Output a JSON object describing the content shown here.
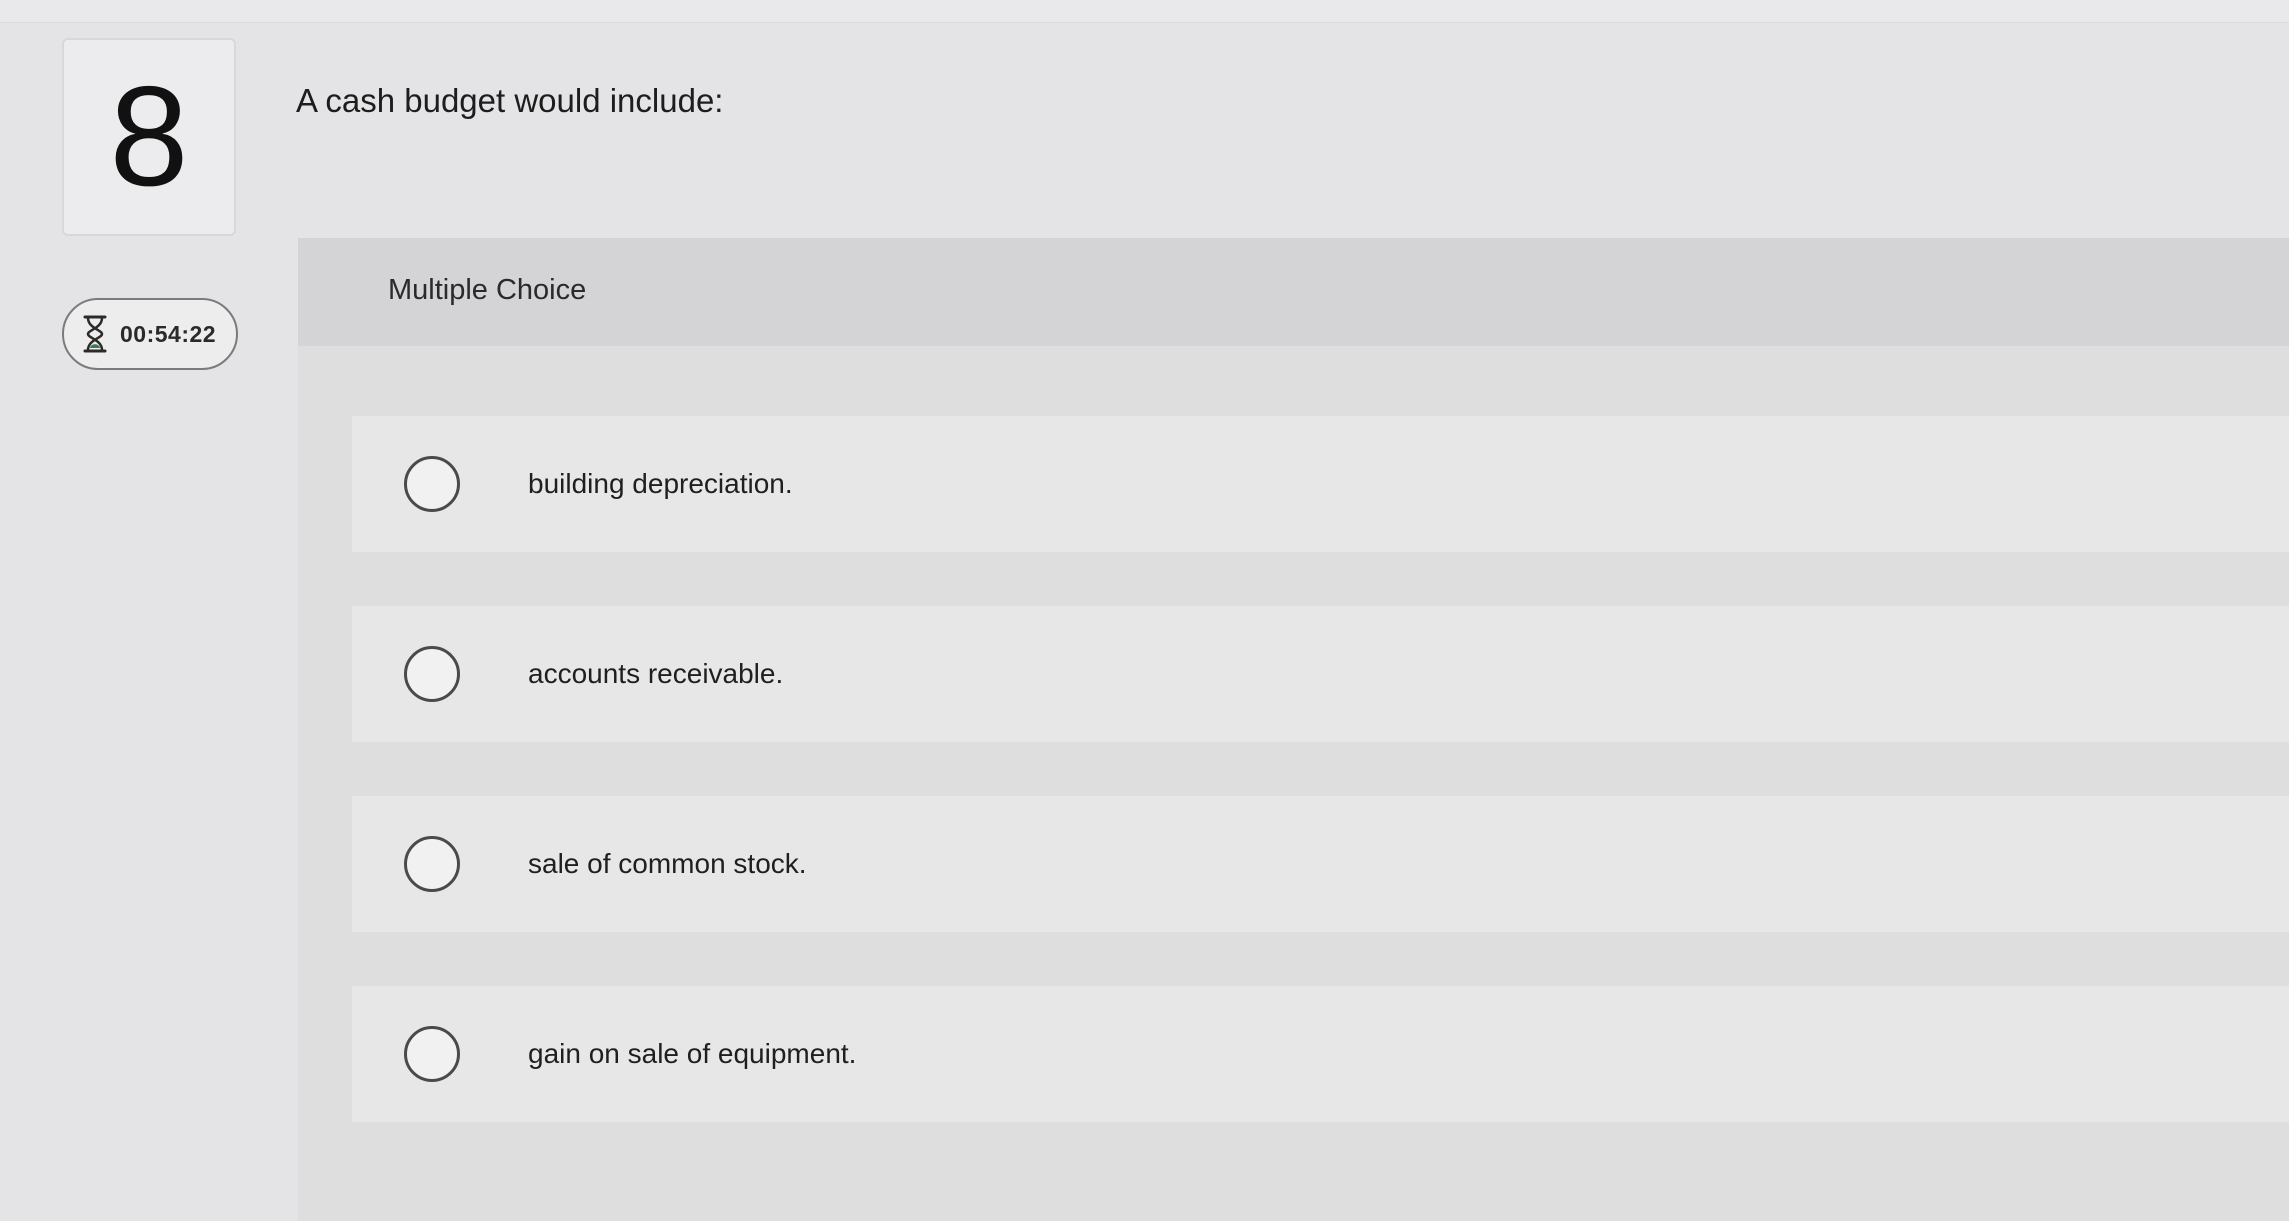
{
  "question": {
    "number": "8",
    "prompt": "A cash budget would include:",
    "type_label": "Multiple Choice"
  },
  "timer": {
    "icon": "hourglass-icon",
    "value": "00:54:22"
  },
  "options": [
    {
      "label": "building depreciation.",
      "selected": false
    },
    {
      "label": "accounts receivable.",
      "selected": false
    },
    {
      "label": "sale of common stock.",
      "selected": false
    },
    {
      "label": "gain on sale of equipment.",
      "selected": false
    }
  ]
}
